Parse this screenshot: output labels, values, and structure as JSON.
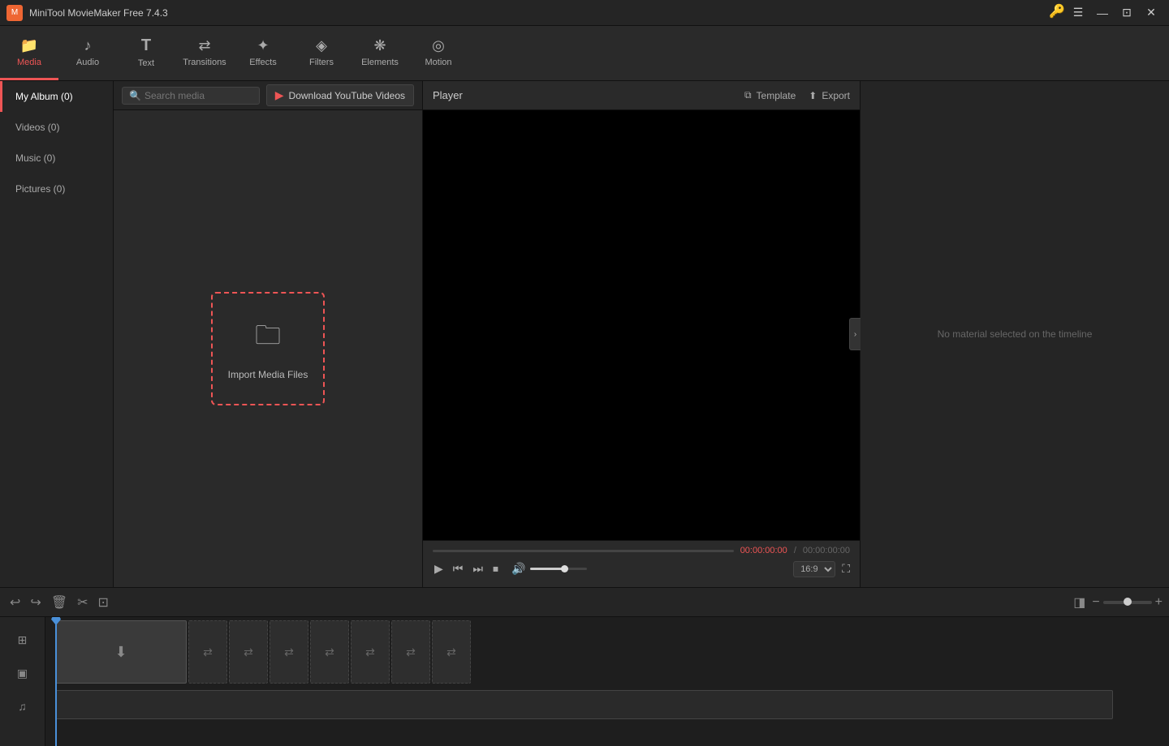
{
  "app": {
    "title": "MiniTool MovieMaker Free 7.4.3",
    "icon_label": "M"
  },
  "title_buttons": {
    "key": "🔑",
    "menu": "☰",
    "minimize": "—",
    "maximize": "⊡",
    "close": "✕"
  },
  "toolbar": {
    "items": [
      {
        "id": "media",
        "icon": "📁",
        "label": "Media",
        "active": true
      },
      {
        "id": "audio",
        "icon": "♪",
        "label": "Audio",
        "active": false
      },
      {
        "id": "text",
        "icon": "T",
        "label": "Text",
        "active": false
      },
      {
        "id": "transitions",
        "icon": "⇄",
        "label": "Transitions",
        "active": false
      },
      {
        "id": "effects",
        "icon": "✦",
        "label": "Effects",
        "active": false
      },
      {
        "id": "filters",
        "icon": "◈",
        "label": "Filters",
        "active": false
      },
      {
        "id": "elements",
        "icon": "❋",
        "label": "Elements",
        "active": false
      },
      {
        "id": "motion",
        "icon": "◎",
        "label": "Motion",
        "active": false
      }
    ]
  },
  "left_nav": {
    "items": [
      {
        "id": "myalbum",
        "label": "My Album (0)",
        "active": true
      },
      {
        "id": "videos",
        "label": "Videos (0)",
        "active": false
      },
      {
        "id": "music",
        "label": "Music (0)",
        "active": false
      },
      {
        "id": "pictures",
        "label": "Pictures (0)",
        "active": false
      }
    ]
  },
  "media_toolbar": {
    "search_placeholder": "Search media",
    "download_label": "Download YouTube Videos",
    "download_icon": "▶"
  },
  "import_box": {
    "icon": "🗀",
    "label": "Import Media Files"
  },
  "player": {
    "title": "Player",
    "template_label": "Template",
    "export_label": "Export",
    "time_current": "00:00:00:00",
    "time_separator": "/",
    "time_total": "00:00:00:00",
    "aspect_ratio": "16:9"
  },
  "right_panel": {
    "no_material_text": "No material selected on the timeline",
    "collapse_icon": "›"
  },
  "timeline": {
    "toolbar": {
      "undo_icon": "↩",
      "redo_icon": "↪",
      "delete_icon": "🗑",
      "cut_icon": "✂",
      "crop_icon": "⊡",
      "split_left_icon": "◨",
      "zoom_minus": "−",
      "zoom_plus": "+"
    },
    "tracks": {
      "video_icon": "▣",
      "audio_icon": "♫"
    }
  },
  "colors": {
    "accent_red": "#e55050",
    "playhead_blue": "#4a90d9",
    "bg_dark": "#1e1e1e",
    "bg_medium": "#252525",
    "bg_light": "#2a2a2a"
  }
}
